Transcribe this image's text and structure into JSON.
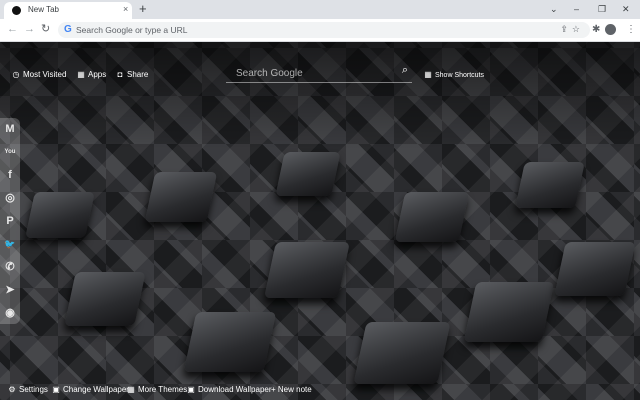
{
  "browser": {
    "tab_title": "New Tab",
    "tab_close": "×",
    "new_tab": "+",
    "omnibox_placeholder": "Search Google or type a URL",
    "controls": {
      "minimize": "–",
      "restore": "❐",
      "close": "✕",
      "collapse": "⌄"
    },
    "nav": {
      "back": "←",
      "forward": "→",
      "reload": "↻"
    },
    "omni_icons": "⇪☆",
    "extensions": "✱",
    "menu": "⋮"
  },
  "topbar": {
    "most_visited": "Most Visited",
    "apps": "Apps",
    "share": "Share",
    "search_placeholder": "Search Google",
    "show_shortcuts": "Show Shortcuts"
  },
  "dock": {
    "items": [
      {
        "name": "gmail-icon",
        "glyph": "M"
      },
      {
        "name": "youtube-icon",
        "glyph": "You"
      },
      {
        "name": "facebook-icon",
        "glyph": "f"
      },
      {
        "name": "instagram-icon",
        "glyph": "◎"
      },
      {
        "name": "pinterest-icon",
        "glyph": "P"
      },
      {
        "name": "twitter-icon",
        "glyph": "🐦"
      },
      {
        "name": "whatsapp-icon",
        "glyph": "✆"
      },
      {
        "name": "telegram-icon",
        "glyph": "➤"
      },
      {
        "name": "reddit-icon",
        "glyph": "◉"
      }
    ]
  },
  "bottombar": {
    "settings": "Settings",
    "change_wallpaper": "Change Wallpaper",
    "more_themes": "More Themes",
    "download_wallpaper": "Download Wallpaper",
    "new_note": "+ New note"
  },
  "colors": {
    "tabstrip": "#dee1e6",
    "omnibox": "#f1f3f4",
    "text_on_wallpaper": "#ffffff"
  }
}
